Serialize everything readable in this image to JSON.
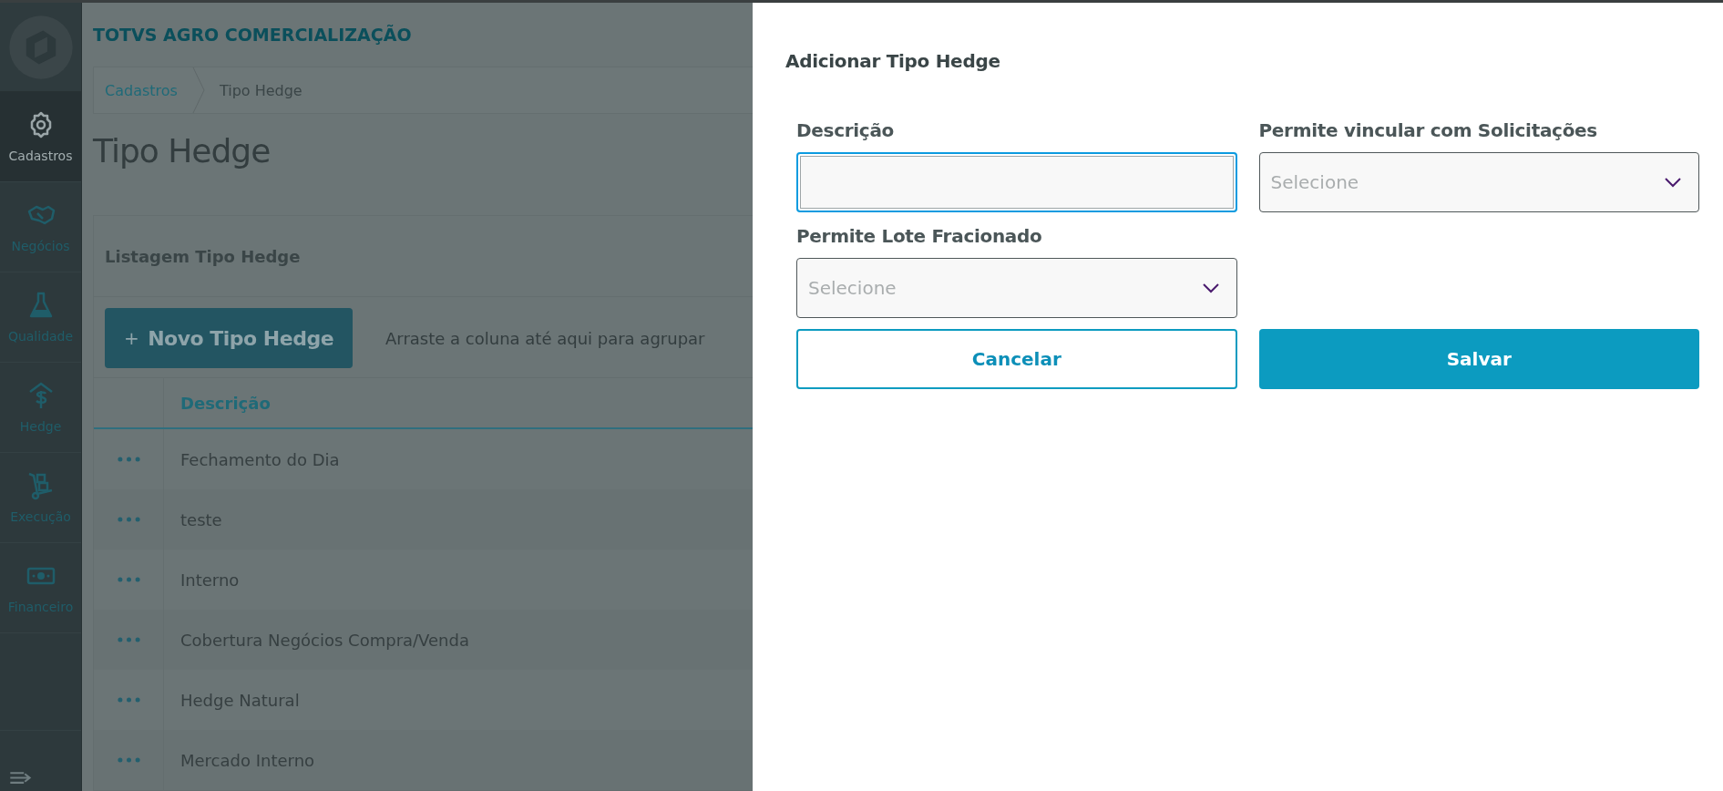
{
  "sidebar": {
    "items": [
      {
        "label": "Cadastros",
        "selected": true
      },
      {
        "label": "Negócios",
        "selected": false
      },
      {
        "label": "Qualidade",
        "selected": false
      },
      {
        "label": "Hedge",
        "selected": false
      },
      {
        "label": "Execução",
        "selected": false
      },
      {
        "label": "Financeiro",
        "selected": false
      }
    ]
  },
  "header": {
    "title": "TOTVS AGRO COMERCIALIZAÇÃO"
  },
  "breadcrumb": [
    "Cadastros",
    "Tipo Hedge"
  ],
  "page_title": "Tipo Hedge",
  "card": {
    "title": "Listagem Tipo Hedge",
    "new_button": {
      "icon_text": "+",
      "label": "Novo Tipo Hedge"
    },
    "group_hint": "Arraste a coluna até aqui para agrupar",
    "table": {
      "columns": [
        "Descrição"
      ],
      "rows": [
        {
          "description": "Fechamento do Dia"
        },
        {
          "description": "teste"
        },
        {
          "description": "Interno"
        },
        {
          "description": "Cobertura Negócios Compra/Venda"
        },
        {
          "description": "Hedge Natural"
        },
        {
          "description": "Mercado Interno"
        }
      ]
    }
  },
  "modal": {
    "title": "Adicionar Tipo Hedge",
    "fields": [
      {
        "kind": "text",
        "label": "Descrição",
        "focused": true
      },
      {
        "kind": "select",
        "label": "Permite vincular com Solicitações",
        "placeholder": "Selecione",
        "focused": false
      },
      {
        "kind": "select",
        "label": "Permite Lote Fracionado",
        "placeholder": "Selecione",
        "focused": false
      }
    ],
    "buttons": [
      {
        "kind": "secondary",
        "label": "Cancelar"
      },
      {
        "kind": "primary",
        "label": "Salvar"
      }
    ]
  }
}
